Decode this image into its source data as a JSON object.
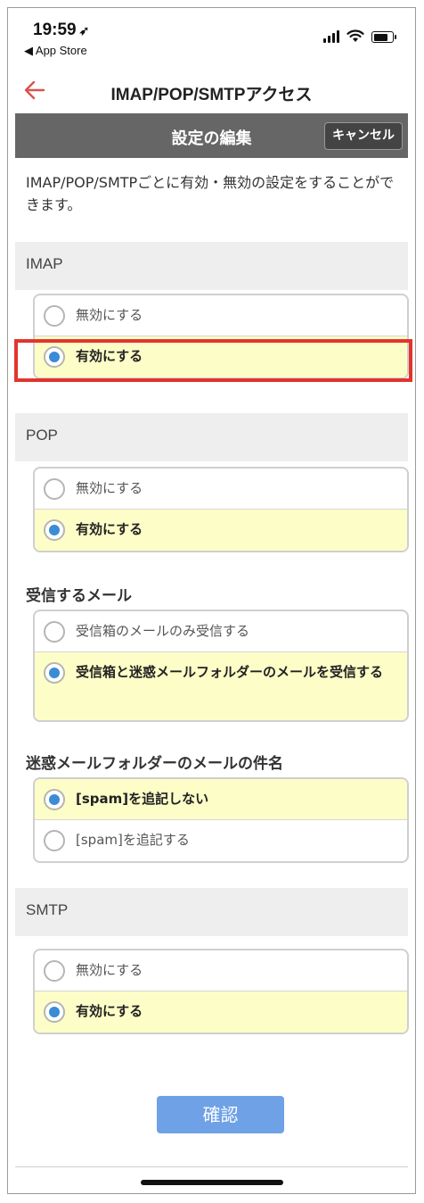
{
  "status_bar": {
    "time": "19:59",
    "location_arrow": "➶",
    "back_app": "◀ App Store"
  },
  "nav": {
    "title": "IMAP/POP/SMTPアクセス",
    "back_icon": "left-arrow-icon"
  },
  "edit_bar": {
    "title": "設定の編集",
    "cancel_label": "キャンセル"
  },
  "description": "IMAP/POP/SMTPごとに有効・無効の設定をすることができます。",
  "sections": {
    "imap": {
      "header": "IMAP",
      "options": [
        {
          "label": "無効にする",
          "selected": false
        },
        {
          "label": "有効にする",
          "selected": true
        }
      ]
    },
    "pop": {
      "header": "POP",
      "options": [
        {
          "label": "無効にする",
          "selected": false
        },
        {
          "label": "有効にする",
          "selected": true
        }
      ]
    },
    "receive": {
      "heading": "受信するメール",
      "options": [
        {
          "label": "受信箱のメールのみ受信する",
          "selected": false
        },
        {
          "label": "受信箱と迷惑メールフォルダーのメールを受信する",
          "selected": true
        }
      ]
    },
    "spam_subject": {
      "heading": "迷惑メールフォルダーのメールの件名",
      "options": [
        {
          "label": "[spam]を追記しない",
          "selected": true
        },
        {
          "label": "[spam]を追記する",
          "selected": false
        }
      ]
    },
    "smtp": {
      "header": "SMTP",
      "options": [
        {
          "label": "無効にする",
          "selected": false
        },
        {
          "label": "有効にする",
          "selected": true
        }
      ]
    }
  },
  "confirm_label": "確認",
  "colors": {
    "accent_red": "#e2352c",
    "selected_bg": "#fdfdc8",
    "radio_blue": "#3b8bd6",
    "button_blue": "#6ea1e6",
    "edit_bar": "#666666"
  }
}
